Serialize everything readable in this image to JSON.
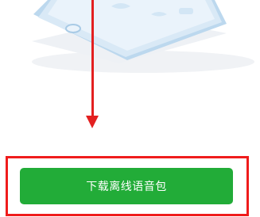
{
  "download": {
    "button_label": "下载离线语音包"
  },
  "colors": {
    "button_green": "#22ac38",
    "annotation_red": "#e32020",
    "phone_blue": "#bcd8ee"
  },
  "icons": {
    "illustration": "phone-illustration-icon",
    "arrow": "arrow-down-icon"
  }
}
